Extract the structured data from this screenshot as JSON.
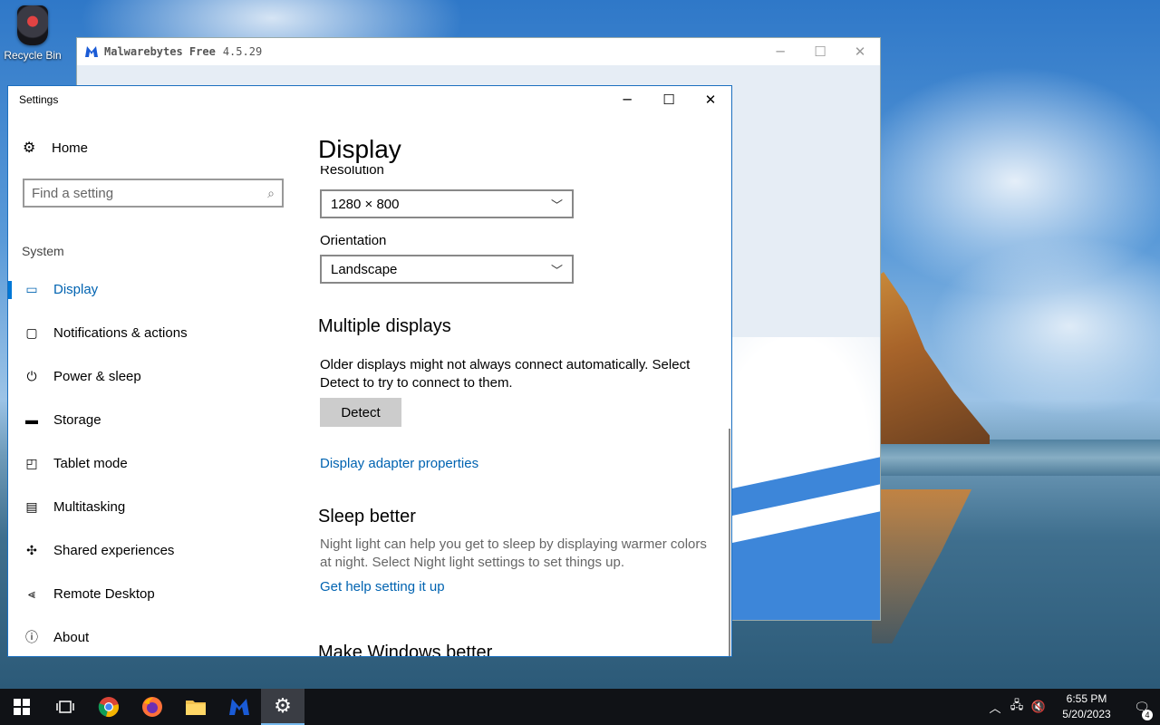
{
  "desktop": {
    "recycle_bin_label": "Recycle Bin"
  },
  "malwarebytes": {
    "title": "Malwarebytes Free",
    "version": "4.5.29"
  },
  "settings": {
    "title": "Settings",
    "nav": {
      "home": "Home",
      "search_placeholder": "Find a setting",
      "group": "System",
      "items": [
        {
          "label": "Display",
          "icon": "monitor-icon",
          "active": true
        },
        {
          "label": "Notifications & actions",
          "icon": "notification-icon"
        },
        {
          "label": "Power & sleep",
          "icon": "power-icon"
        },
        {
          "label": "Storage",
          "icon": "storage-icon"
        },
        {
          "label": "Tablet mode",
          "icon": "tablet-icon"
        },
        {
          "label": "Multitasking",
          "icon": "multitasking-icon"
        },
        {
          "label": "Shared experiences",
          "icon": "shared-icon"
        },
        {
          "label": "Remote Desktop",
          "icon": "remote-icon"
        },
        {
          "label": "About",
          "icon": "info-icon"
        }
      ]
    },
    "main": {
      "heading": "Display",
      "resolution_label": "Resolution",
      "resolution_value": "1280 × 800",
      "orientation_label": "Orientation",
      "orientation_value": "Landscape",
      "multiple_heading": "Multiple displays",
      "multiple_text": "Older displays might not always connect automatically. Select Detect to try to connect to them.",
      "detect_button": "Detect",
      "adapter_link": "Display adapter properties",
      "sleep_heading": "Sleep better",
      "sleep_text": "Night light can help you get to sleep by displaying warmer colors at night. Select Night light settings to set things up.",
      "sleep_link": "Get help setting it up",
      "make_better_heading": "Make Windows better"
    }
  },
  "taskbar": {
    "time": "6:55 PM",
    "date": "5/20/2023",
    "notification_count": "4"
  },
  "colors": {
    "accent": "#0078d7",
    "link": "#0063b1"
  }
}
